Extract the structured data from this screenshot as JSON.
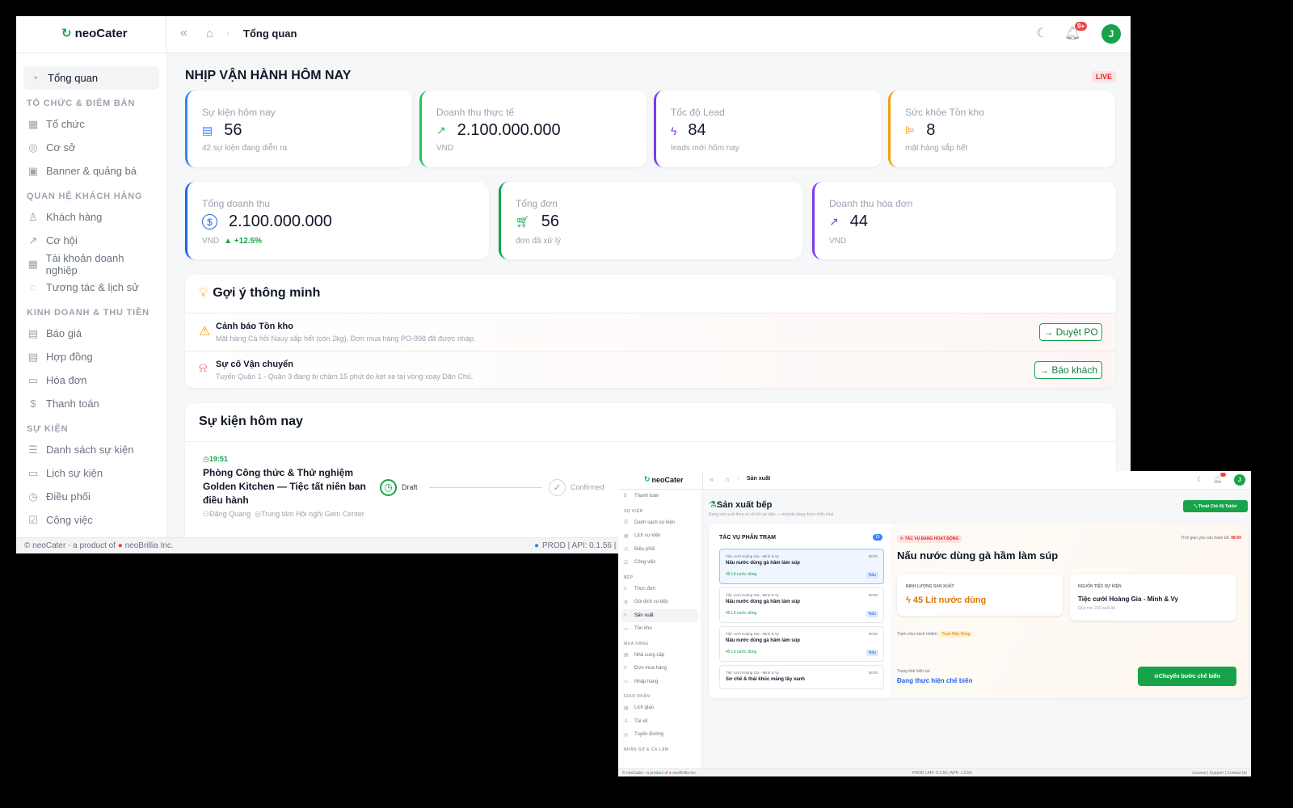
{
  "main": {
    "logo": "neoCater",
    "breadcrumb": "Tổng quan",
    "notif_badge": "9+",
    "avatar": "J",
    "sidebar": {
      "active": "Tổng quan",
      "sections": [
        {
          "title": "TỔ CHỨC & ĐIỂM BÁN",
          "items": [
            "Tổ chức",
            "Cơ sở",
            "Banner & quảng bá"
          ]
        },
        {
          "title": "QUAN HỆ KHÁCH HÀNG",
          "items": [
            "Khách hàng",
            "Cơ hội",
            "Tài khoản doanh nghiệp",
            "Tương tác & lịch sử"
          ]
        },
        {
          "title": "KINH DOANH & THU TIỀN",
          "items": [
            "Báo giá",
            "Hợp đồng",
            "Hóa đơn",
            "Thanh toán"
          ]
        },
        {
          "title": "SỰ KIỆN",
          "items": [
            "Danh sách sự kiện",
            "Lịch sự kiện",
            "Điều phối",
            "Công việc"
          ]
        }
      ]
    },
    "heading": "NHỊP VẬN HÀNH HÔM NAY",
    "live": "LIVE",
    "kpis_row1": [
      {
        "label": "Sự kiện hôm nay",
        "value": "56",
        "sub": "42 sự kiện đang diễn ra",
        "icon": "calendar-icon",
        "color": "#3b82f6"
      },
      {
        "label": "Doanh thu thực tế",
        "value": "2.100.000.000",
        "sub": "VND",
        "icon": "trend-icon",
        "color": "#22c55e"
      },
      {
        "label": "Tốc độ Lead",
        "value": "84",
        "sub": "leads mới hôm nay",
        "icon": "bolt-icon",
        "color": "#7c3aed"
      },
      {
        "label": "Sức khỏe Tồn kho",
        "value": "8",
        "sub": "mặt hàng sắp hết",
        "icon": "barbell-icon",
        "color": "#f59e0b"
      }
    ],
    "kpis_row2": [
      {
        "label": "Tổng doanh thu",
        "value": "2.100.000.000",
        "sub": "VND",
        "delta": "▲ +12.5%",
        "icon": "dollar-icon",
        "color": "#2563eb"
      },
      {
        "label": "Tổng đơn",
        "value": "56",
        "sub": "đơn đã xử lý",
        "icon": "cart-icon",
        "color": "#16a34a"
      },
      {
        "label": "Doanh thu hóa đơn",
        "value": "44",
        "sub": "VND",
        "icon": "chart-icon",
        "color": "#7c3aed"
      }
    ],
    "suggest_title": "Gợi ý thông minh",
    "suggestions": [
      {
        "title": "Cảnh báo Tồn kho",
        "desc": "Mặt hàng Cá hồi Nauy sắp hết (còn 2kg). Đơn mua hàng PO-998 đã được nháp.",
        "action": "Duyệt PO"
      },
      {
        "title": "Sự cố Vận chuyển",
        "desc": "Tuyến Quận 1 - Quận 3 đang bị chậm 15 phút do kẹt xe tại vòng xoay Dân Chủ.",
        "action": "Báo khách"
      }
    ],
    "events_title": "Sự kiện hôm nay",
    "event": {
      "time": "19:51",
      "name": "Phòng Công thức & Thử nghiệm Golden Kitchen — Tiệc tất niên ban điều hành",
      "person": "Đặng Quang",
      "place": "Trung tâm Hội nghị Gem Center",
      "step1": "Draft",
      "step2": "Confirmed"
    },
    "footer_left": "neoCater - a product of",
    "footer_brand": "neoBrillia Inc.",
    "footer_right": "PROD | API: 0.1.56 | AP"
  },
  "second": {
    "logo": "neoCater",
    "breadcrumb": "Sản xuất",
    "avatar": "J",
    "sidebar": [
      {
        "type": "item",
        "label": "Thanh toán"
      },
      {
        "type": "sec",
        "label": "SỰ KIỆN"
      },
      {
        "type": "item",
        "label": "Danh sách sự kiện"
      },
      {
        "type": "item",
        "label": "Lịch sự kiện"
      },
      {
        "type": "item",
        "label": "Điều phối"
      },
      {
        "type": "item",
        "label": "Công việc"
      },
      {
        "type": "sec",
        "label": "BẾP"
      },
      {
        "type": "item",
        "label": "Thực đơn"
      },
      {
        "type": "item",
        "label": "Gói dịch vụ bếp"
      },
      {
        "type": "item",
        "label": "Sản xuất",
        "active": true
      },
      {
        "type": "item",
        "label": "Tồn kho"
      },
      {
        "type": "sec",
        "label": "MUA HÀNG"
      },
      {
        "type": "item",
        "label": "Nhà cung cấp"
      },
      {
        "type": "item",
        "label": "Đơn mua hàng"
      },
      {
        "type": "item",
        "label": "Nhập hàng"
      },
      {
        "type": "sec",
        "label": "GIAO NHẬN"
      },
      {
        "type": "item",
        "label": "Lịch giao"
      },
      {
        "type": "item",
        "label": "Tài xế"
      },
      {
        "type": "item",
        "label": "Tuyến đường"
      },
      {
        "type": "sec",
        "label": "NHÂN SỰ & CA LÀM"
      }
    ],
    "title": "Sản xuất bếp",
    "subtitle": "Đang sản xuất theo ca và hồi sự kiện — module đang được triển khai",
    "tablet_btn": "Thoát Chế độ Tablet",
    "queue_title": "TÁC VỤ PHÂN TRẠM",
    "queue_count": "15",
    "tasks": [
      {
        "event": "Tiệc cưới Hoàng Gia - Minh & Vy",
        "time": "08:00",
        "name": "Nấu nước dùng gà hầm làm súp",
        "qty": "45 Lít nước dùng",
        "tag": "Nấu"
      },
      {
        "event": "Tiệc cưới Hoàng Gia - Minh & Vy",
        "time": "08:00",
        "name": "Nấu nước dùng gà hầm làm súp",
        "qty": "45 Lít nước dùng",
        "tag": "Nấu"
      },
      {
        "event": "Tiệc cưới Hoàng Gia - Minh & Vy",
        "time": "08:00",
        "name": "Nấu nước dùng gà hầm làm súp",
        "qty": "45 Lít nước dùng",
        "tag": "Nấu"
      },
      {
        "event": "Tiệc cưới Hoàng Gia - Minh & Vy",
        "time": "08:00",
        "name": "Sơ chế & thái khúc măng tây xanh",
        "qty": "",
        "tag": ""
      }
    ],
    "active_badge": "TÁC VỤ ĐANG HOẠT ĐỘNG",
    "deadline_label": "Thời gian yêu cầu hoàn tất:",
    "deadline": "08:00",
    "active_title": "Nấu nước dùng gà hầm làm súp",
    "qty_label": "ĐỊNH LƯỢNG SẢN XUẤT",
    "qty_value": "45 Lít nước dùng",
    "source_label": "NGUỒN TIỆC SỰ KIỆN",
    "source_value": "Tiệc cưới Hoàng Gia - Minh & Vy",
    "source_sub": "Quy mô: 220 suất ăn",
    "station_label": "Trạm chịu trách nhiệm:",
    "station": "Trạm Bếp Nóng",
    "status_label": "Trạng thái hiện tại:",
    "status": "Đang thực hiện chế biến",
    "next_btn": "Chuyển bước chế biến",
    "footer_left": "neoCater - a product of",
    "footer_brand": "neoBrillia Inc.",
    "footer_mid": "PROD | API: 0.1.56 | APP: 1.0.56",
    "footer_right": "License | Support | Contact Us"
  }
}
